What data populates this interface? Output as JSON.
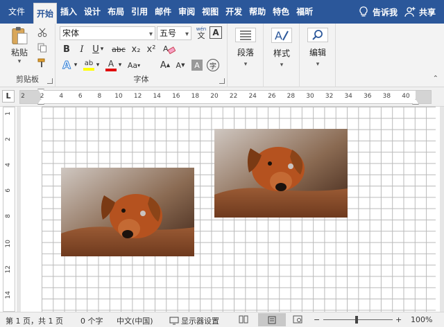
{
  "tabs": [
    "文件",
    "开始",
    "插入",
    "设计",
    "布局",
    "引用",
    "邮件",
    "审阅",
    "视图",
    "开发",
    "帮助",
    "特色",
    "福昕"
  ],
  "tell_me": "告诉我",
  "share": "共享",
  "clipboard": {
    "paste_label": "粘贴",
    "group_label": "剪贴板"
  },
  "font": {
    "font_name": "宋体",
    "font_size": "五号",
    "group_label": "字体",
    "wen_label": "wén",
    "wen_char": "文",
    "bold": "B",
    "italic": "I",
    "underline": "U",
    "strike": "abc",
    "subscript": "x₂",
    "superscript": "x²",
    "grow": "A",
    "shrink": "A",
    "aa": "Aa",
    "char_shade": "A",
    "enclose": "字",
    "border_char": "A",
    "highlight_letter": "ab",
    "font_color_letter": "A",
    "effects_letter": "A"
  },
  "paragraph": {
    "label": "段落"
  },
  "styles": {
    "label": "样式"
  },
  "editing": {
    "label": "编辑"
  },
  "colors": {
    "accent": "#2b579a",
    "highlight": "#ffff00",
    "font_color": "#e00000"
  },
  "ruler": {
    "tab_type": "L",
    "h_numbers": [
      "2",
      "2",
      "4",
      "6",
      "8",
      "10",
      "12",
      "14",
      "16",
      "18",
      "20",
      "22",
      "24",
      "26",
      "28",
      "30",
      "32",
      "34",
      "36",
      "38",
      "40"
    ],
    "v_numbers": [
      "1",
      "2",
      "4",
      "6",
      "8",
      "10",
      "12",
      "14"
    ]
  },
  "status": {
    "page": "第 1 页，共 1 页",
    "words": "0 个字",
    "lang": "中文(中国)",
    "display": "显示器设置",
    "zoom": "100%",
    "zoom_minus": "−",
    "zoom_plus": "+"
  }
}
